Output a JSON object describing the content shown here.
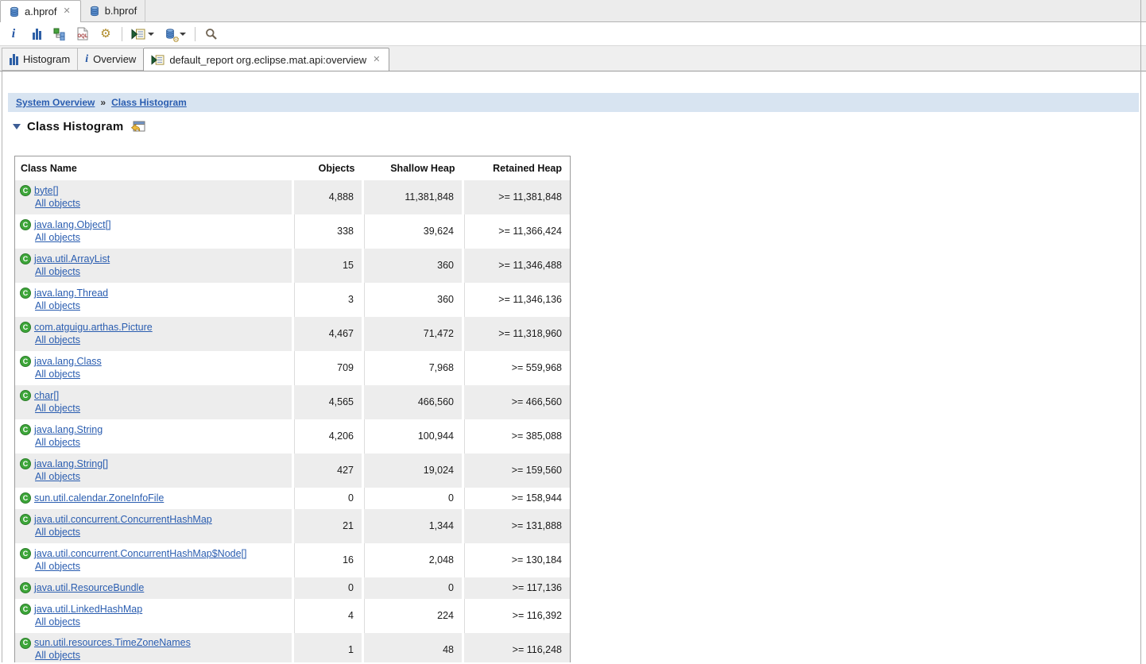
{
  "icons": {
    "close": "✕",
    "class_badge": "C",
    "info_glyph": "i",
    "oql_label": "OQL",
    "gear_glyph": "⚙"
  },
  "editor_tabs": [
    {
      "label": "a.hprof",
      "active": true
    },
    {
      "label": "b.hprof",
      "active": false
    }
  ],
  "view_tabs": [
    {
      "label": "Histogram"
    },
    {
      "label": "Overview"
    },
    {
      "label": "default_report org.eclipse.mat.api:overview",
      "active": true
    }
  ],
  "breadcrumb": {
    "separator": "»",
    "links": [
      {
        "label": "System Overview"
      },
      {
        "label": "Class Histogram"
      }
    ]
  },
  "section": {
    "title": "Class Histogram"
  },
  "table": {
    "headers": [
      "Class Name",
      "Objects",
      "Shallow Heap",
      "Retained Heap"
    ],
    "all_objects_label": "All objects",
    "rows": [
      {
        "class_name": "byte[]",
        "objects": "4,888",
        "shallow_heap": "11,381,848",
        "retained_heap": ">= 11,381,848",
        "has_all_objects": true
      },
      {
        "class_name": "java.lang.Object[]",
        "objects": "338",
        "shallow_heap": "39,624",
        "retained_heap": ">= 11,366,424",
        "has_all_objects": true
      },
      {
        "class_name": "java.util.ArrayList",
        "objects": "15",
        "shallow_heap": "360",
        "retained_heap": ">= 11,346,488",
        "has_all_objects": true
      },
      {
        "class_name": "java.lang.Thread",
        "objects": "3",
        "shallow_heap": "360",
        "retained_heap": ">= 11,346,136",
        "has_all_objects": true
      },
      {
        "class_name": "com.atguigu.arthas.Picture",
        "objects": "4,467",
        "shallow_heap": "71,472",
        "retained_heap": ">= 11,318,960",
        "has_all_objects": true
      },
      {
        "class_name": "java.lang.Class",
        "objects": "709",
        "shallow_heap": "7,968",
        "retained_heap": ">= 559,968",
        "has_all_objects": true
      },
      {
        "class_name": "char[]",
        "objects": "4,565",
        "shallow_heap": "466,560",
        "retained_heap": ">= 466,560",
        "has_all_objects": true
      },
      {
        "class_name": "java.lang.String",
        "objects": "4,206",
        "shallow_heap": "100,944",
        "retained_heap": ">= 385,088",
        "has_all_objects": true
      },
      {
        "class_name": "java.lang.String[]",
        "objects": "427",
        "shallow_heap": "19,024",
        "retained_heap": ">= 159,560",
        "has_all_objects": true
      },
      {
        "class_name": "sun.util.calendar.ZoneInfoFile",
        "objects": "0",
        "shallow_heap": "0",
        "retained_heap": ">= 158,944",
        "has_all_objects": false
      },
      {
        "class_name": "java.util.concurrent.ConcurrentHashMap",
        "objects": "21",
        "shallow_heap": "1,344",
        "retained_heap": ">= 131,888",
        "has_all_objects": true
      },
      {
        "class_name": "java.util.concurrent.ConcurrentHashMap$Node[]",
        "objects": "16",
        "shallow_heap": "2,048",
        "retained_heap": ">= 130,184",
        "has_all_objects": true
      },
      {
        "class_name": "java.util.ResourceBundle",
        "objects": "0",
        "shallow_heap": "0",
        "retained_heap": ">= 117,136",
        "has_all_objects": false
      },
      {
        "class_name": "java.util.LinkedHashMap",
        "objects": "4",
        "shallow_heap": "224",
        "retained_heap": ">= 116,392",
        "has_all_objects": true
      },
      {
        "class_name": "sun.util.resources.TimeZoneNames",
        "objects": "1",
        "shallow_heap": "48",
        "retained_heap": ">= 116,248",
        "has_all_objects": true
      }
    ]
  }
}
